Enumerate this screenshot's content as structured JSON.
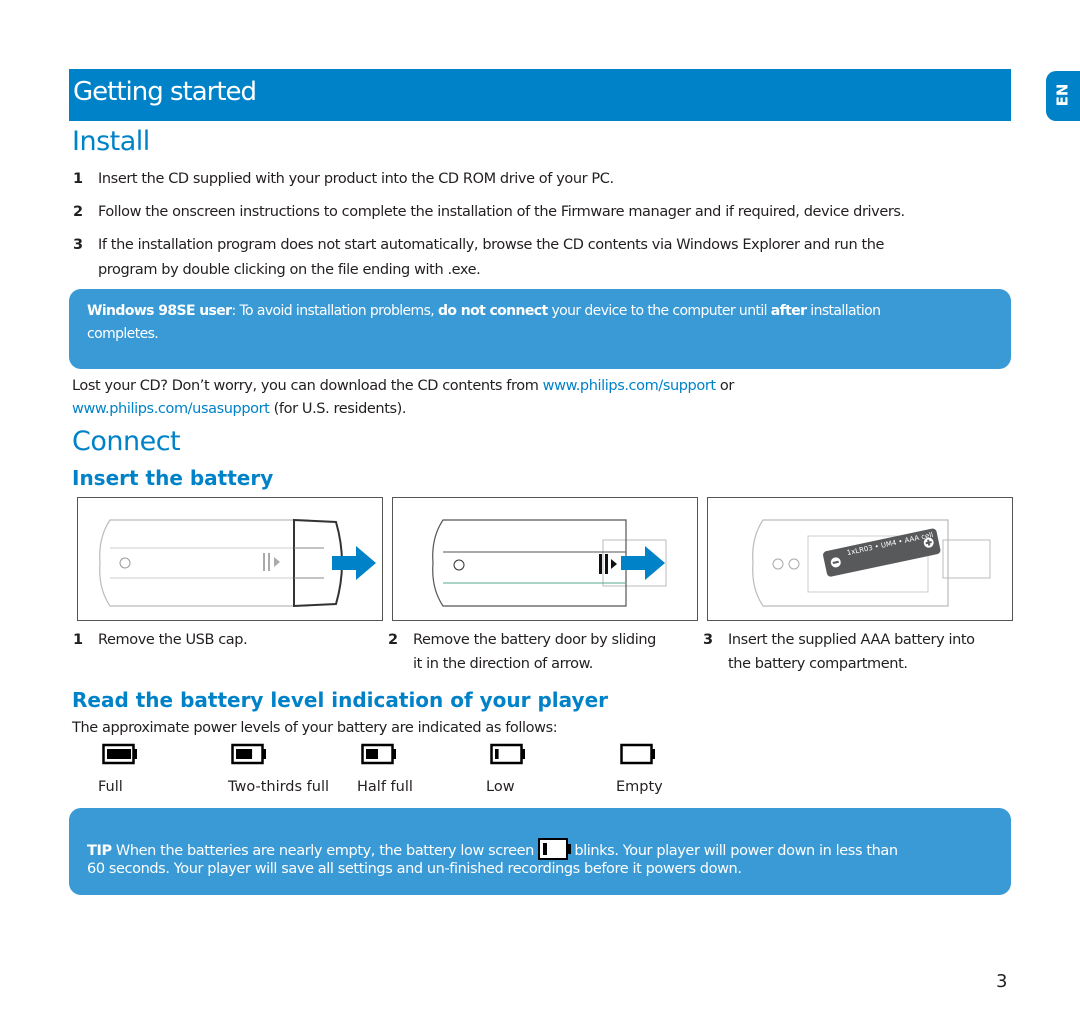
{
  "header": {
    "title": "Getting started",
    "lang_tab": "EN"
  },
  "install": {
    "heading": "Install",
    "steps": [
      {
        "num": "1",
        "text": "Insert the CD supplied with your product into the CD ROM drive of your PC."
      },
      {
        "num": "2",
        "text": "Follow the onscreen instructions to complete the installation of the Firmware manager and if required, device drivers."
      },
      {
        "num": "3",
        "text_line1": "If the installation program does not start automatically, browse the CD contents via Windows Explorer and run the",
        "text_line2": "program by double clicking on the file ending with .exe."
      }
    ],
    "callout": {
      "bold1": "Windows 98SE user",
      "text1": ": To avoid installation problems, ",
      "bold2": "do not connect",
      "text2": " your device to the computer until ",
      "bold3": "after",
      "text3": " installation",
      "line2": "completes."
    },
    "lost_cd": {
      "text1": "Lost your CD? Don’t worry, you can download the CD contents from ",
      "link1": "www.philips.com/support",
      "text2": " or",
      "link2": "www.philips.com/usasupport",
      "text3": " (for U.S. residents)."
    }
  },
  "connect": {
    "heading": "Connect",
    "insert_battery": {
      "heading": "Insert the battery",
      "battery_label": "1xLR03 • UM4 • AAA cell",
      "colors": {
        "arrow": "#0082c8",
        "battery": "#58595b"
      },
      "steps": [
        {
          "num": "1",
          "line1": "Remove the USB cap.",
          "line2": ""
        },
        {
          "num": "2",
          "line1": "Remove the battery door by sliding",
          "line2": "it in the direction of arrow."
        },
        {
          "num": "3",
          "line1": "Insert the supplied AAA battery into",
          "line2": "the battery compartment."
        }
      ]
    },
    "battery_level": {
      "heading": "Read the battery level indication of your player",
      "intro": "The approximate power levels of your battery are indicated as follows:",
      "levels": [
        {
          "label": "Full",
          "fill": 1.0
        },
        {
          "label": "Two-thirds full",
          "fill": 0.67
        },
        {
          "label": "Half full",
          "fill": 0.5
        },
        {
          "label": "Low",
          "fill": 0.15
        },
        {
          "label": "Empty",
          "fill": 0.0
        }
      ]
    },
    "tip": {
      "label": "TIP",
      "text1": " When the batteries are nearly empty, the battery low screen ",
      "text2": " blinks. Your player will power down in less than",
      "line2": "60 seconds. Your player will save all settings and un-finished recordings before it powers down."
    }
  },
  "footer": {
    "page_number": "3"
  },
  "colors": {
    "brand_blue": "#0082c8",
    "callout_blue": "#3a9ad6"
  }
}
